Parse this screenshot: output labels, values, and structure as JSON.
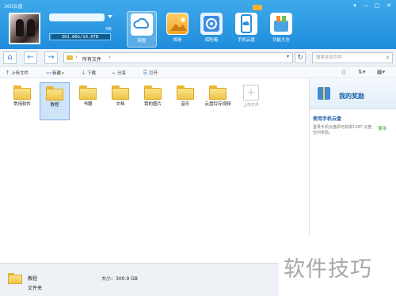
{
  "window": {
    "app_title": "360云盘",
    "controls": [
      "▾",
      "—",
      "□",
      "✕"
    ]
  },
  "user": {
    "level": "4级",
    "usage": "301.86G/10.0TB",
    "usage_fraction": 0.03
  },
  "nav": [
    {
      "label": "网盘",
      "icon": "cloud-disk-icon",
      "active": true
    },
    {
      "label": "相册",
      "icon": "photo-album-icon",
      "active": false
    },
    {
      "label": "保险箱",
      "icon": "safe-box-icon",
      "active": false
    },
    {
      "label": "手机云盘",
      "icon": "phone-cloud-icon",
      "active": false
    },
    {
      "label": "功能大全",
      "icon": "apps-icon",
      "active": false
    }
  ],
  "address": {
    "crumb": "所有文件",
    "search_placeholder": "搜索全部文件"
  },
  "toolbar": {
    "upload": "上传文件",
    "new": "新建",
    "download": "下载",
    "share": "分享",
    "open": "打开"
  },
  "files": [
    {
      "name": "常用软件",
      "selected": false
    },
    {
      "name": "教程",
      "selected": true
    },
    {
      "name": "书籍",
      "selected": false
    },
    {
      "name": "文档",
      "selected": false
    },
    {
      "name": "我的图片",
      "selected": false
    },
    {
      "name": "音乐",
      "selected": false
    },
    {
      "name": "云盘铃存视频",
      "selected": false
    }
  ],
  "upload_tile": {
    "label": "上传文件"
  },
  "reward": {
    "title": "我的奖励",
    "subtitle": "使用手机云盘",
    "description": "登录手机云盘即可获得128T 云盘空间奖励。",
    "use": "使用"
  },
  "status": {
    "name": "教程",
    "type": "文件夹",
    "size": "大小：300.9 GB"
  },
  "watermark": "软件技巧"
}
